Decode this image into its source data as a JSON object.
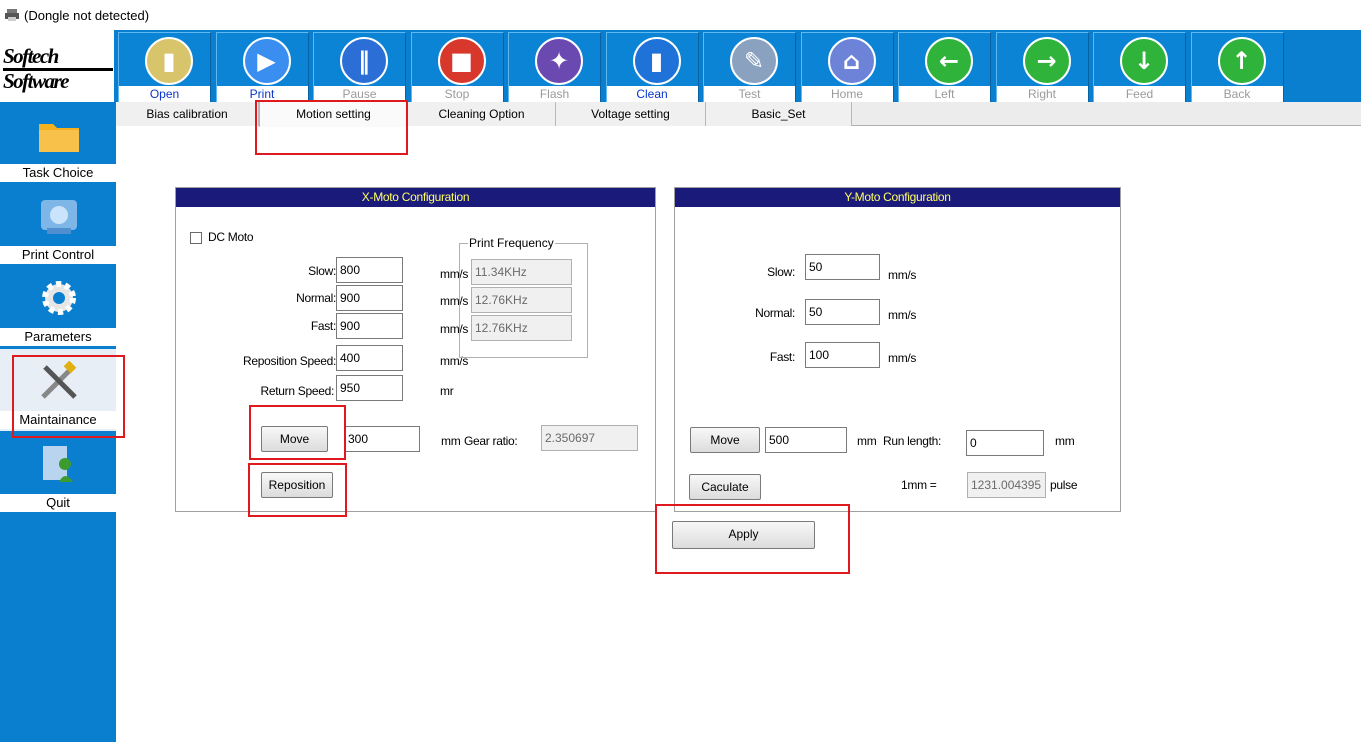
{
  "window": {
    "title": "(Dongle not detected)"
  },
  "logo": {
    "text": "Softech Software"
  },
  "toolbar": {
    "buttons": [
      {
        "label": "Open",
        "icon": "open-folder-icon",
        "state": "active",
        "color": "#d8c46a"
      },
      {
        "label": "Print",
        "icon": "play-icon",
        "state": "active",
        "color": "#3a8ef0"
      },
      {
        "label": "Pause",
        "icon": "pause-icon",
        "state": "disabled",
        "color": "#2b6fd6"
      },
      {
        "label": "Stop",
        "icon": "stop-icon",
        "state": "disabled",
        "color": "#d8382c"
      },
      {
        "label": "Flash",
        "icon": "flash-icon",
        "state": "disabled",
        "color": "#6a4ab0"
      },
      {
        "label": "Clean",
        "icon": "clean-bottle-icon",
        "state": "active",
        "color": "#1f72d8"
      },
      {
        "label": "Test",
        "icon": "test-document-icon",
        "state": "disabled",
        "color": "#8aa2c0"
      },
      {
        "label": "Home",
        "icon": "home-icon",
        "state": "disabled",
        "color": "#6d83d8"
      },
      {
        "label": "Left",
        "icon": "arrow-left-icon",
        "state": "disabled",
        "color": "#2fb33a"
      },
      {
        "label": "Right",
        "icon": "arrow-right-icon",
        "state": "disabled",
        "color": "#2fb33a"
      },
      {
        "label": "Feed",
        "icon": "arrow-down-icon",
        "state": "disabled",
        "color": "#2fb33a"
      },
      {
        "label": "Back",
        "icon": "arrow-up-icon",
        "state": "disabled",
        "color": "#2fb33a"
      }
    ]
  },
  "sidebar": {
    "items": [
      {
        "label": "Task Choice",
        "icon": "folder-icon"
      },
      {
        "label": "Print Control",
        "icon": "print-control-icon"
      },
      {
        "label": "Parameters",
        "icon": "gear-icon"
      },
      {
        "label": "Maintainance",
        "icon": "tools-icon",
        "selected": true
      },
      {
        "label": "Quit",
        "icon": "quit-icon"
      }
    ]
  },
  "tabs": [
    {
      "label": "Bias calibration"
    },
    {
      "label": "Motion setting",
      "active": true
    },
    {
      "label": "Cleaning Option"
    },
    {
      "label": "Voltage setting"
    },
    {
      "label": "Basic_Set"
    }
  ],
  "xmoto": {
    "title": "X-Moto Configuration",
    "dc_moto_label": "DC Moto",
    "dc_moto_checked": false,
    "slow_label": "Slow:",
    "slow_value": "800",
    "slow_unit": "mm/s",
    "normal_label": "Normal:",
    "normal_value": "900",
    "normal_unit": "mm/s",
    "fast_label": "Fast:",
    "fast_value": "900",
    "fast_unit": "mm/s",
    "reposition_speed_label": "Reposition Speed:",
    "reposition_speed_value": "400",
    "reposition_speed_unit": "mm/s",
    "return_speed_label": "Return Speed:",
    "return_speed_value": "950",
    "return_speed_unit": "mr",
    "print_frequency": {
      "legend": "Print Frequency",
      "values": [
        "11.34KHz",
        "12.76KHz",
        "12.76KHz"
      ]
    },
    "move_label": "Move",
    "move_value": "300",
    "move_unit": "mm",
    "gear_ratio_label": "Gear ratio:",
    "gear_ratio_value": "2.350697",
    "reposition_label": "Reposition"
  },
  "ymoto": {
    "title": "Y-Moto Configuration",
    "slow_label": "Slow:",
    "slow_value": "50",
    "slow_unit": "mm/s",
    "normal_label": "Normal:",
    "normal_value": "50",
    "normal_unit": "mm/s",
    "fast_label": "Fast:",
    "fast_value": "100",
    "fast_unit": "mm/s",
    "move_label": "Move",
    "move_value": "500",
    "move_unit": "mm",
    "run_length_label": "Run length:",
    "run_length_value": "0",
    "run_length_unit": "mm",
    "caculate_label": "Caculate",
    "one_mm_label": "1mm =",
    "one_mm_value": "1231.004395",
    "one_mm_unit": "pulse"
  },
  "apply_label": "Apply",
  "colors": {
    "toolbar_blue": "#0a7fd0",
    "header_navy": "#1a1a7a",
    "header_text": "#ffff66",
    "highlight_red": "#e0191f"
  }
}
